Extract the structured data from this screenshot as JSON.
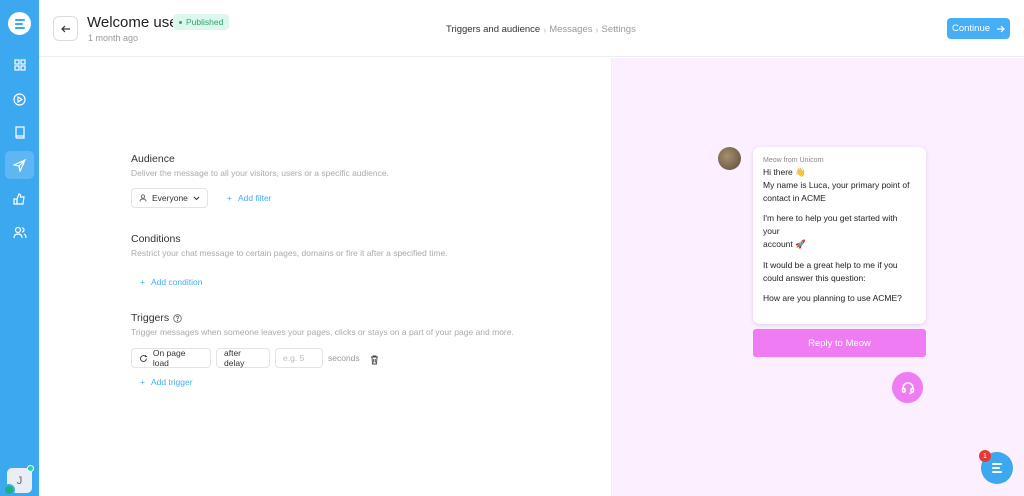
{
  "header": {
    "title": "Welcome user",
    "status": "Published",
    "subtitle": "1 month ago",
    "breadcrumb": [
      "Triggers and audience",
      "Messages",
      "Settings"
    ],
    "continue_label": "Continue"
  },
  "sidebar": {
    "items": [
      "dashboard",
      "play",
      "book",
      "send",
      "thumbs-up",
      "users"
    ],
    "active": "send",
    "user_initial": "J"
  },
  "audience": {
    "title": "Audience",
    "description": "Deliver the message to all your visitors, users or a specific audience.",
    "selected": "Everyone",
    "add_filter": "Add filter"
  },
  "conditions": {
    "title": "Conditions",
    "description": "Restrict your chat message to certain pages, domains or fire it after a specified time.",
    "add_condition": "Add condition"
  },
  "triggers": {
    "title": "Triggers",
    "description": "Trigger messages when someone leaves your pages, clicks or stays on a part of your page and more.",
    "trigger_type": "On page load",
    "timing": "after delay",
    "delay_placeholder": "e.g. 5",
    "seconds_label": "seconds",
    "add_trigger": "Add trigger"
  },
  "preview": {
    "sender": "Meow from Unicorn",
    "lines": [
      "Hi there 👋",
      "My name is Luca, your primary point of",
      "contact in ACME",
      "",
      "I'm here to help you get started with your",
      "account 🚀",
      "",
      "It would be a great help to me if you",
      "could answer this question:",
      "",
      "How are you planning to use ACME?"
    ],
    "reply_label": "Reply to Meow"
  },
  "support": {
    "badge_count": "1"
  },
  "colors": {
    "accent": "#45aef5",
    "sidebar": "#3ba8f0",
    "preview_accent": "#ef7cf2",
    "preview_bg": "#fcefff"
  }
}
